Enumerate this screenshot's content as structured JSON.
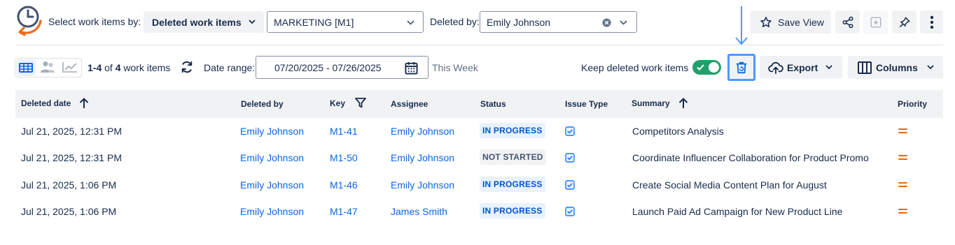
{
  "toolbar": {
    "select_label": "Select work items by:",
    "mode_label": "Deleted work items",
    "project_value": "MARKETING [M1]",
    "deleted_by_label": "Deleted by:",
    "deleted_by_value": "Emily Johnson",
    "save_view_label": "Save View"
  },
  "subbar": {
    "range_start": "1-4",
    "of_text": "of",
    "total": "4",
    "items_text": "work items",
    "date_range_label": "Date range:",
    "date_range_value": "07/20/2025 - 07/26/2025",
    "date_range_hint": "This Week",
    "keep_deleted_label": "Keep deleted work items",
    "keep_deleted_on": true,
    "export_label": "Export",
    "columns_label": "Columns"
  },
  "table": {
    "headers": {
      "deleted_date": "Deleted date",
      "deleted_by": "Deleted by",
      "key": "Key",
      "assignee": "Assignee",
      "status": "Status",
      "issue_type": "Issue Type",
      "summary": "Summary",
      "priority": "Priority"
    },
    "rows": [
      {
        "deleted_date": "Jul 21, 2025, 12:31 PM",
        "deleted_by": "Emily Johnson",
        "key": "M1-41",
        "assignee": "Emily Johnson",
        "status": "IN PROGRESS",
        "summary": "Competitors Analysis"
      },
      {
        "deleted_date": "Jul 21, 2025, 12:31 PM",
        "deleted_by": "Emily Johnson",
        "key": "M1-50",
        "assignee": "Emily Johnson",
        "status": "NOT STARTED",
        "summary": "Coordinate Influencer Collaboration for Product Promo"
      },
      {
        "deleted_date": "Jul 21, 2025, 1:06 PM",
        "deleted_by": "Emily Johnson",
        "key": "M1-46",
        "assignee": "Emily Johnson",
        "status": "IN PROGRESS",
        "summary": "Create Social Media Content Plan for August"
      },
      {
        "deleted_date": "Jul 21, 2025, 1:06 PM",
        "deleted_by": "Emily Johnson",
        "key": "M1-47",
        "assignee": "James Smith",
        "status": "IN PROGRESS",
        "summary": "Launch Paid Ad Campaign for New Product Line"
      }
    ]
  },
  "icons": {
    "logo": "history-clock-icon",
    "grid_view": "grid-view-icon",
    "people_view": "people-icon",
    "chart_view": "trend-chart-icon",
    "refresh": "refresh-icon",
    "calendar": "calendar-icon",
    "trash": "trash-restore-icon",
    "export": "cloud-upload-icon",
    "columns": "columns-icon",
    "save": "star-icon",
    "share": "share-icon",
    "pin": "pin-icon",
    "more": "more-vertical-icon",
    "priority": "priority-medium-icon",
    "issue_type": "task-checkbox-icon"
  },
  "colors": {
    "accent": "#0c66e4",
    "toggle_on": "#22a06b",
    "priority_medium": "#e56910",
    "highlight": "#4c9aff"
  }
}
